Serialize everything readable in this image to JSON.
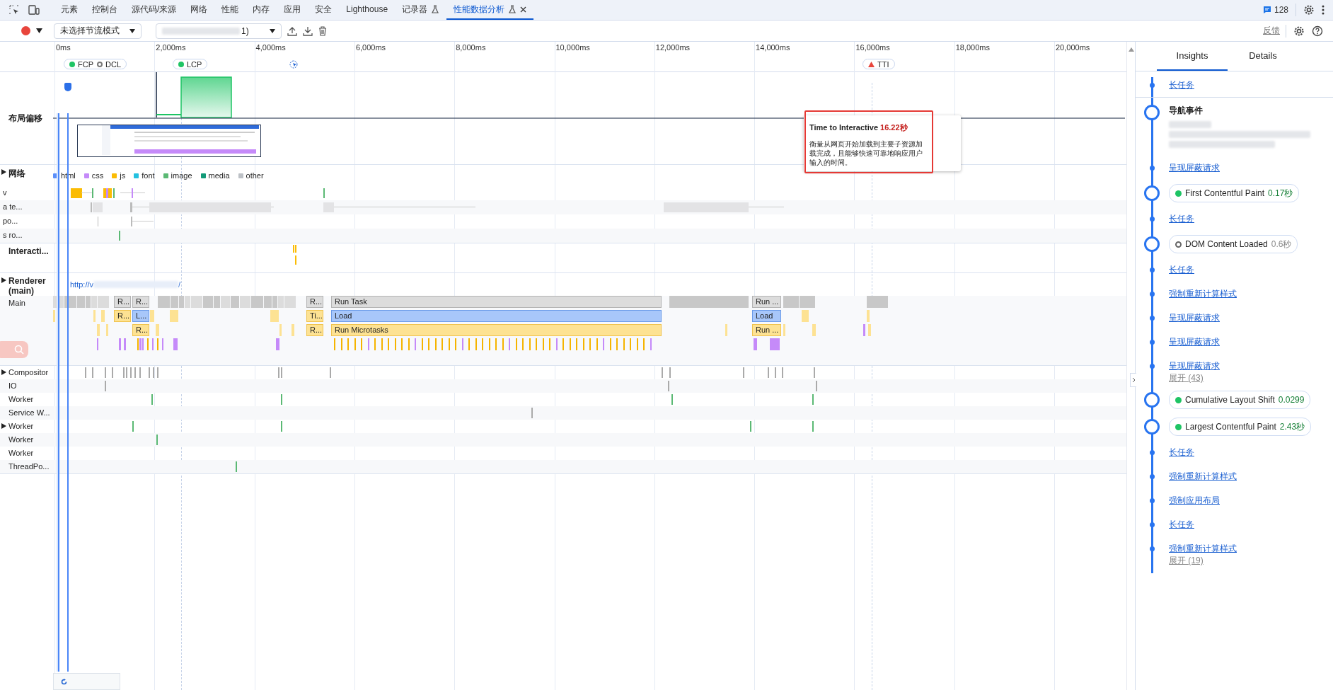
{
  "tabbar": {
    "tabs": [
      {
        "label": "元素",
        "selected": false,
        "experimental": false,
        "closable": false
      },
      {
        "label": "控制台",
        "selected": false,
        "experimental": false,
        "closable": false
      },
      {
        "label": "源代码/来源",
        "selected": false,
        "experimental": false,
        "closable": false
      },
      {
        "label": "网络",
        "selected": false,
        "experimental": false,
        "closable": false
      },
      {
        "label": "性能",
        "selected": false,
        "experimental": false,
        "closable": false
      },
      {
        "label": "内存",
        "selected": false,
        "experimental": false,
        "closable": false
      },
      {
        "label": "应用",
        "selected": false,
        "experimental": false,
        "closable": false
      },
      {
        "label": "安全",
        "selected": false,
        "experimental": false,
        "closable": false
      },
      {
        "label": "Lighthouse",
        "selected": false,
        "experimental": false,
        "closable": false
      },
      {
        "label": "记录器",
        "selected": false,
        "experimental": true,
        "closable": false
      },
      {
        "label": "性能数据分析",
        "selected": true,
        "experimental": true,
        "closable": true
      }
    ],
    "issues": "128"
  },
  "toolbar": {
    "throttling": "未选择节流模式",
    "recording": "1)",
    "feedback": "反馈"
  },
  "ruler": {
    "ticks": [
      "0ms",
      "2,000ms",
      "4,000ms",
      "6,000ms",
      "8,000ms",
      "10,000ms",
      "12,000ms",
      "14,000ms",
      "16,000ms",
      "18,000ms",
      "20,000ms"
    ],
    "markers": [
      {
        "kind": "chip",
        "entries": [
          {
            "label": "FCP",
            "kind": "dot",
            "color": "#1ec464",
            "filled": true
          },
          {
            "label": "DCL",
            "kind": "dot",
            "color": "#777777",
            "filled": false
          }
        ]
      },
      {
        "kind": "chip",
        "entries": [
          {
            "label": "LCP",
            "kind": "dot",
            "color": "#1ec464",
            "filled": true
          }
        ]
      },
      {
        "kind": "icon"
      },
      {
        "kind": "chip",
        "entries": [
          {
            "label": "TTI",
            "kind": "triangle",
            "color": "#e8453c",
            "filled": true
          }
        ]
      }
    ]
  },
  "tooltip": {
    "title": "Time to Interactive",
    "value": "16.22秒",
    "description": "衡量从网页开始加载到主要子资源加载完成，且能够快速可靠地响应用户输入的时间。",
    "highlighted": true
  },
  "tracks": [
    {
      "kind": "layout-shift",
      "label": "布局偏移"
    },
    {
      "kind": "network",
      "label": "网络",
      "expanded": false,
      "legend": [
        {
          "label": "html",
          "color": "#5b8ff9"
        },
        {
          "label": "css",
          "color": "#c58af9"
        },
        {
          "label": "js",
          "color": "#fbbc04"
        },
        {
          "label": "font",
          "color": "#24c1e0"
        },
        {
          "label": "image",
          "color": "#5bb974"
        },
        {
          "label": "media",
          "color": "#129a78"
        },
        {
          "label": "other",
          "color": "#bdc1c6"
        }
      ],
      "rows": [
        "v",
        "a te...",
        "po...",
        "s ro..."
      ]
    },
    {
      "kind": "interactions",
      "label": "Interacti..."
    },
    {
      "kind": "renderer",
      "label": "Renderer (main)",
      "expanded": false,
      "url_start": "http://v",
      "url_end": "/"
    },
    {
      "kind": "main",
      "label": "Main",
      "rows": [
        [
          {
            "label": "R...",
            "kind": "task"
          },
          {
            "label": "R...",
            "kind": "task"
          },
          {
            "label": "R...",
            "kind": "task"
          },
          {
            "label": "Run Task",
            "kind": "task"
          },
          {
            "label": "Run ...",
            "kind": "task"
          }
        ],
        [
          {
            "label": "R...",
            "kind": "script"
          },
          {
            "label": "L...",
            "kind": "load"
          },
          {
            "label": "Ti...",
            "kind": "script"
          },
          {
            "label": "Load",
            "kind": "load"
          },
          {
            "label": "Load",
            "kind": "load"
          }
        ],
        [
          "",
          {
            "label": "R...",
            "kind": "script"
          },
          {
            "label": "R...",
            "kind": "script"
          },
          {
            "label": "Run Microtasks",
            "kind": "script"
          },
          {
            "label": "Run ...",
            "kind": "script"
          }
        ]
      ]
    },
    {
      "kind": "thread",
      "label": "Compositor",
      "expanded": false
    },
    {
      "kind": "thread",
      "label": "IO"
    },
    {
      "kind": "thread",
      "label": "Worker"
    },
    {
      "kind": "thread",
      "label": "Service W..."
    },
    {
      "kind": "thread",
      "label": "Worker",
      "expanded": false
    },
    {
      "kind": "thread",
      "label": "Worker"
    },
    {
      "kind": "thread",
      "label": "Worker"
    },
    {
      "kind": "thread",
      "label": "ThreadPo..."
    }
  ],
  "sidebar": {
    "tabs": [
      {
        "label": "Insights",
        "selected": true
      },
      {
        "label": "Details",
        "selected": false
      }
    ],
    "items": [
      {
        "kind": "link",
        "label": "长任务"
      },
      {
        "kind": "navigation",
        "label": "导航事件"
      },
      {
        "kind": "link",
        "label": "呈现屏蔽请求"
      },
      {
        "kind": "metric",
        "label": "First Contentful Paint",
        "value": "0.17秒",
        "color": "#1ec464",
        "filled": true
      },
      {
        "kind": "link",
        "label": "长任务"
      },
      {
        "kind": "metric",
        "label": "DOM Content Loaded",
        "value": "0.6秒",
        "color": "#666666",
        "filled": false
      },
      {
        "kind": "link",
        "label": "长任务"
      },
      {
        "kind": "link",
        "label": "强制重新计算样式"
      },
      {
        "kind": "link",
        "label": "呈现屏蔽请求"
      },
      {
        "kind": "link",
        "label": "呈现屏蔽请求"
      },
      {
        "kind": "link",
        "label": "呈现屏蔽请求"
      },
      {
        "kind": "more",
        "label": "展开 (43)"
      },
      {
        "kind": "metric",
        "label": "Cumulative Layout Shift",
        "value": "0.0299",
        "color": "#1ec464",
        "filled": true
      },
      {
        "kind": "metric",
        "label": "Largest Contentful Paint",
        "value": "2.43秒",
        "color": "#1ec464",
        "filled": true
      },
      {
        "kind": "link",
        "label": "长任务"
      },
      {
        "kind": "link",
        "label": "强制重新计算样式"
      },
      {
        "kind": "link",
        "label": "强制应用布局"
      },
      {
        "kind": "link",
        "label": "长任务"
      },
      {
        "kind": "link",
        "label": "强制重新计算样式"
      },
      {
        "kind": "more",
        "label": "展开 (19)"
      }
    ]
  }
}
